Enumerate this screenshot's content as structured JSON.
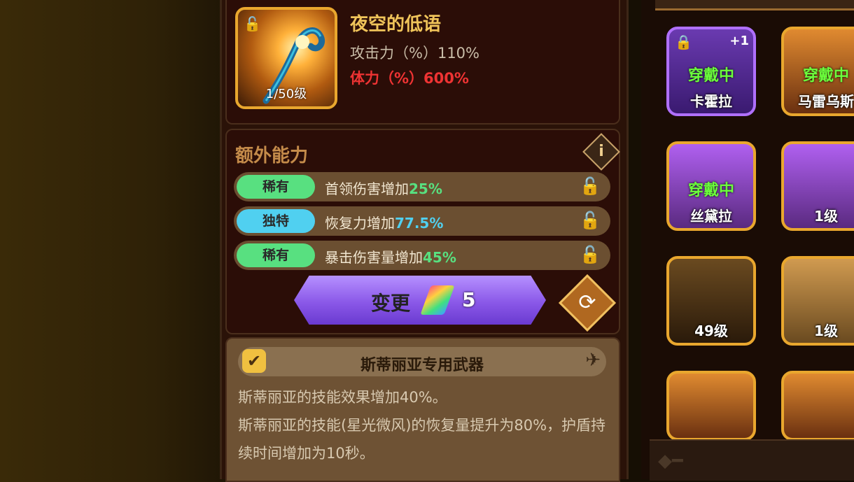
{
  "item": {
    "name": "夜空的低语",
    "level": "1/50级",
    "stat_attack": "攻击力（%）110%",
    "stat_hp": "体力（%）600%"
  },
  "extra": {
    "title": "额外能力",
    "info": "i",
    "abilities": [
      {
        "rarity": "稀有",
        "text": "首领伤害增加",
        "value": "25%",
        "color": "#58e080"
      },
      {
        "rarity": "独特",
        "text": "恢复力增加",
        "value": "77.5%",
        "color": "#50d0f0"
      },
      {
        "rarity": "稀有",
        "text": "暴击伤害量增加",
        "value": "45%",
        "color": "#58e080"
      }
    ],
    "change_label": "变更",
    "change_cost": "5"
  },
  "exclusive": {
    "title": "斯蒂丽亚专用武器",
    "desc1": "斯蒂丽亚的技能效果增加40%。",
    "desc2": "斯蒂丽亚的技能(星光微风)的恢复量提升为80%，护盾持续时间增加为10秒。"
  },
  "inventory": [
    {
      "label": "卡霍拉",
      "equipped": "穿戴中",
      "plus": "+1",
      "bg": "#5a2a9a"
    },
    {
      "label": "马雷乌斯",
      "equipped": "穿戴中",
      "bg": "#c06a20"
    },
    {
      "label": "丝黛拉",
      "equipped": "穿戴中",
      "bg": "#8a3ad0"
    },
    {
      "label": "1级",
      "bg": "#9a3ad0"
    },
    {
      "label": "49级",
      "bg": "#3a2060"
    },
    {
      "label": "1级",
      "bg": "#c08a40"
    },
    {
      "label": "",
      "bg": "#c06a20"
    },
    {
      "label": "",
      "bg": "#c06a20"
    }
  ]
}
